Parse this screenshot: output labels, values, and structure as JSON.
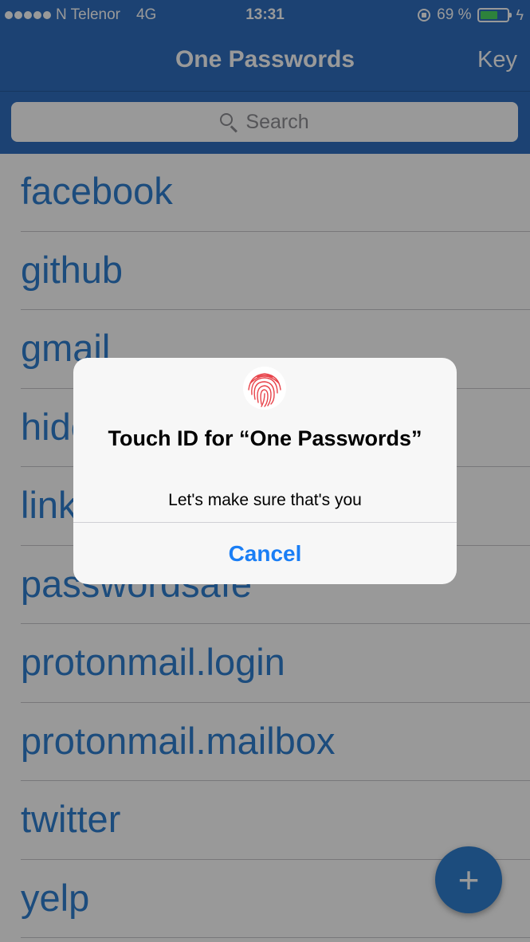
{
  "status_bar": {
    "carrier": "N Telenor",
    "network": "4G",
    "time": "13:31",
    "battery_text": "69 %",
    "battery_level": 0.69,
    "icons": [
      "signal-dots-icon",
      "rotation-lock-icon",
      "battery-icon",
      "charging-bolt-icon"
    ]
  },
  "nav": {
    "title": "One Passwords",
    "right_button": "Key"
  },
  "search": {
    "placeholder": "Search",
    "icon": "search-icon"
  },
  "list": {
    "items": [
      {
        "label": "facebook"
      },
      {
        "label": "github"
      },
      {
        "label": "gmail"
      },
      {
        "label": "hidemyass"
      },
      {
        "label": "linkedin"
      },
      {
        "label": "passwordsafe"
      },
      {
        "label": "protonmail.login"
      },
      {
        "label": "protonmail.mailbox"
      },
      {
        "label": "twitter"
      },
      {
        "label": "yelp"
      }
    ]
  },
  "fab": {
    "label": "+",
    "icon": "plus-icon"
  },
  "alert": {
    "icon": "fingerprint-icon",
    "title": "Touch ID for “One Passwords”",
    "message": "Let's make sure that's you",
    "cancel_label": "Cancel"
  },
  "colors": {
    "nav_blue": "#2f6fc0",
    "link_blue": "#2f7fd0",
    "alert_button_blue": "#1a7ef5",
    "battery_green": "#4cd964",
    "fingerprint_red": "#e8434a"
  }
}
